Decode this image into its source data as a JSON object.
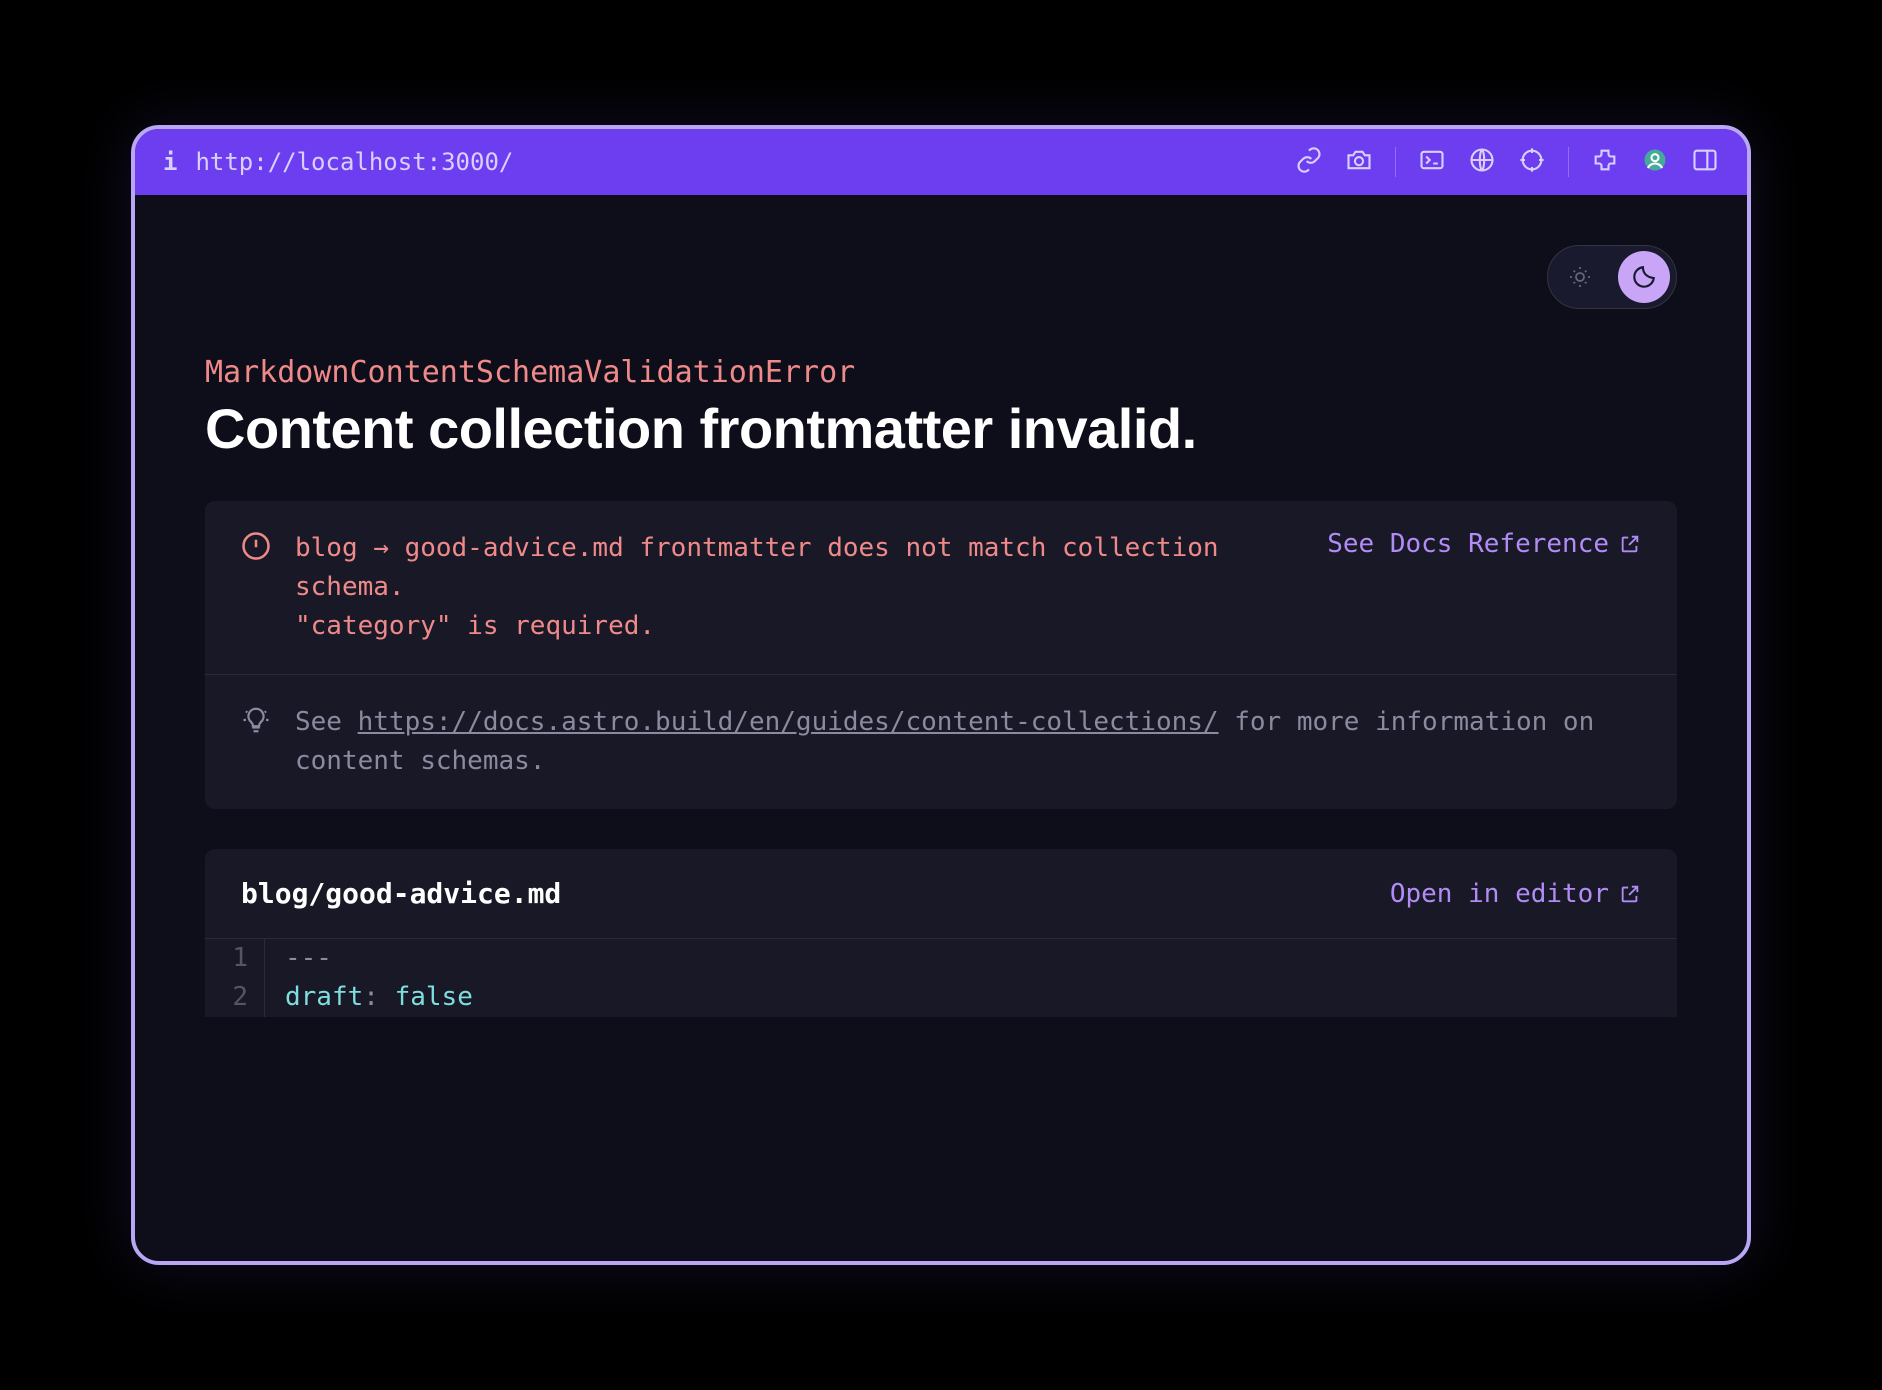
{
  "browser": {
    "url": "http://localhost:3000/"
  },
  "error": {
    "type": "MarkdownContentSchemaValidationError",
    "title": "Content collection frontmatter invalid.",
    "message": "blog → good-advice.md frontmatter does not match collection schema.\n\"category\" is required.",
    "docs_link_label": "See Docs Reference",
    "hint_prefix": "See ",
    "hint_url": "https://docs.astro.build/en/guides/content-collections/",
    "hint_suffix": " for more information on content schemas."
  },
  "file": {
    "path": "blog/good-advice.md",
    "open_label": "Open in editor",
    "lines": [
      {
        "n": "1",
        "raw": "---"
      },
      {
        "n": "2",
        "key": "draft",
        "val": "false"
      }
    ]
  }
}
